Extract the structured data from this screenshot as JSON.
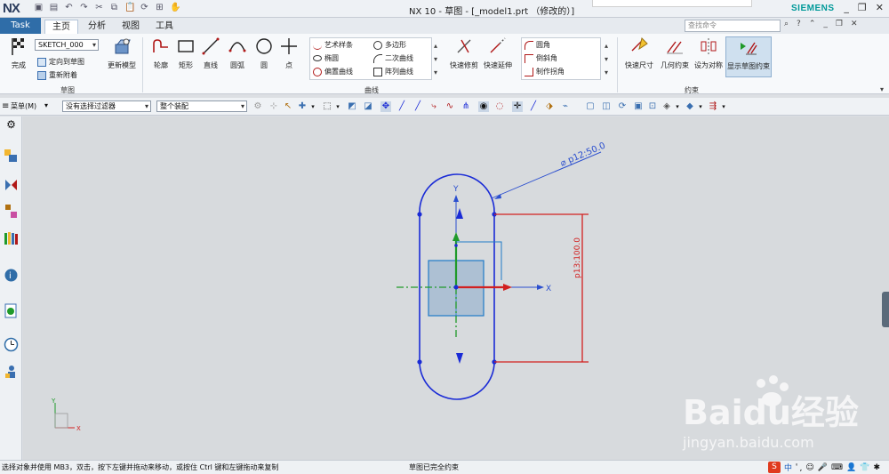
{
  "app": {
    "logo": "NX",
    "title": "NX 10 - 草图 - [_model1.prt （修改的）]",
    "brand": "SIEMENS",
    "window_controls": [
      "_",
      "❐",
      "✕"
    ]
  },
  "tabs": [
    {
      "label": "Task"
    },
    {
      "label": "主页"
    },
    {
      "label": "分析"
    },
    {
      "label": "视图"
    },
    {
      "label": "工具"
    }
  ],
  "search": {
    "placeholder": "查找命令"
  },
  "ribbon": {
    "sketch_group": {
      "finish_label": "完成",
      "sketch_name": "SKETCH_000",
      "orient_label": "定向到草图",
      "reattach_label": "重新附着",
      "update_label": "更新模型",
      "group_label": "草图"
    },
    "curve_group": {
      "profile": "轮廓",
      "rectangle": "矩形",
      "line": "直线",
      "arc": "圆弧",
      "circle": "圆",
      "point": "点",
      "studio_spline": "艺术样条",
      "ellipse": "椭圆",
      "offset_curve": "偏置曲线",
      "polygon": "多边形",
      "conic": "二次曲线",
      "pattern_curve": "阵列曲线",
      "quick_trim": "快速修剪",
      "quick_extend": "快速延伸",
      "fillet": "圆角",
      "chamfer": "倒斜角",
      "make_corner": "制作拐角",
      "group_label": "曲线"
    },
    "constraint_group": {
      "rapid_dimension": "快速尺寸",
      "geometric_constraints": "几何约束",
      "make_symmetric": "设为对称",
      "show_constraints": "显示草图约束",
      "group_label": "约束"
    }
  },
  "selection_bar": {
    "menu_label": "菜单(M)",
    "filter_value": "没有选择过滤器",
    "scope_value": "整个装配"
  },
  "sketch": {
    "dim_diameter": "⌀ p12:50.0",
    "dim_length": "p13:100.0",
    "axis_x": "X",
    "axis_y": "Y",
    "triad_x": "X",
    "triad_y": "Y"
  },
  "status": {
    "prompt": "选择对象并使用 MB3，双击，按下左键并拖动来移动，或按住 Ctrl 键和左键拖动来复制",
    "message": "草图已完全约束"
  },
  "watermark": {
    "text": "Baidu经验",
    "url": "jingyan.baidu.com"
  },
  "tray": {
    "ime_label": "中"
  },
  "colors": {
    "task_tab": "#2f6da8",
    "sketch_curve": "#1a2bd6",
    "dimension": "#d22020",
    "axis_green": "#1f9a2a",
    "datum_blue": "#2b4fcf",
    "brand": "#009999"
  }
}
